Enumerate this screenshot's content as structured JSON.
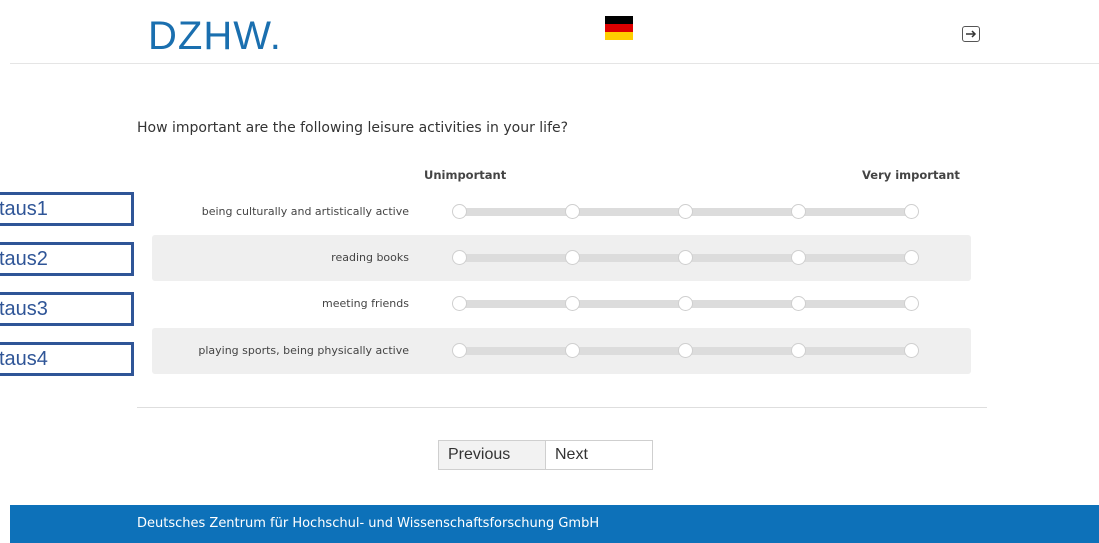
{
  "header": {
    "logo": "DZHW.",
    "flag_colors": [
      "#000000",
      "#dd0000",
      "#ffce00"
    ],
    "language_icon": "german-flag-icon",
    "logout_icon": "logout-icon"
  },
  "question": {
    "text": "How important are the following leisure activities in your life?",
    "scale_min_label": "Unimportant",
    "scale_max_label": "Very important",
    "scale_points": 5,
    "items": [
      {
        "label": "being culturally and artistically active",
        "tag": "taus1"
      },
      {
        "label": "reading books",
        "tag": "taus2"
      },
      {
        "label": "meeting friends",
        "tag": "taus3"
      },
      {
        "label": "playing sports, being physically active",
        "tag": "taus4"
      }
    ]
  },
  "nav": {
    "previous": "Previous",
    "next": "Next"
  },
  "footer": {
    "text": "Deutsches Zentrum für Hochschul- und Wissenschaftsforschung GmbH"
  },
  "colors": {
    "brand": "#1a6faf",
    "footer_bg": "#0d71b9",
    "tag_border": "#2f5597"
  }
}
